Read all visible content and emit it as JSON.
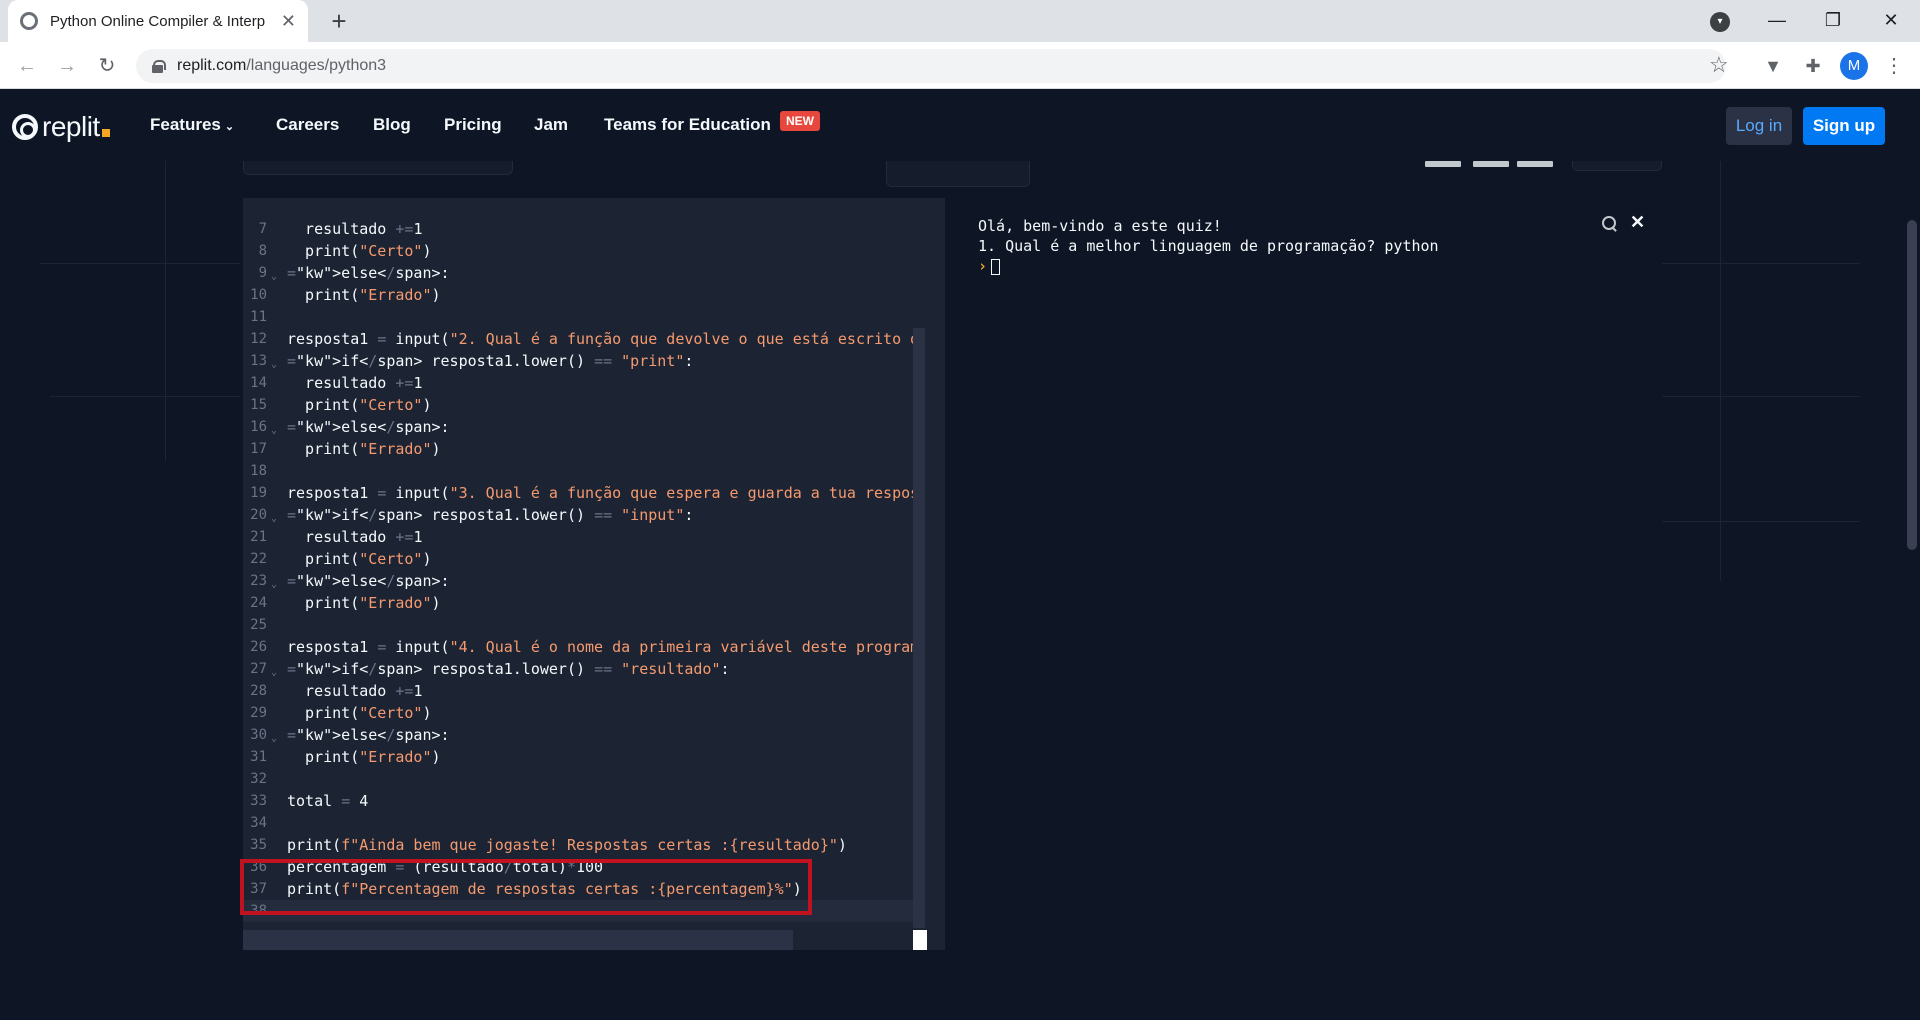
{
  "browser": {
    "tab_title": "Python Online Compiler & Interp",
    "url_host": "replit.com",
    "url_path": "/languages/python3",
    "profile_initial": "M"
  },
  "nav": {
    "logo_text": "replit",
    "items": [
      "Features",
      "Careers",
      "Blog",
      "Pricing",
      "Jam",
      "Teams for Education"
    ],
    "new_badge": "NEW",
    "login": "Log in",
    "signup": "Sign up"
  },
  "editor": {
    "lines": [
      {
        "n": "7",
        "code": "  resultado +=1"
      },
      {
        "n": "8",
        "code": "  print(\"Certo\")"
      },
      {
        "n": "9",
        "code": "else:",
        "fold": true
      },
      {
        "n": "10",
        "code": "  print(\"Errado\")"
      },
      {
        "n": "11",
        "code": ""
      },
      {
        "n": "12",
        "code": "resposta1 = input(\"2. Qual é a função que devolve o que está escrito d"
      },
      {
        "n": "13",
        "code": "if resposta1.lower() == \"print\":",
        "fold": true
      },
      {
        "n": "14",
        "code": "  resultado +=1"
      },
      {
        "n": "15",
        "code": "  print(\"Certo\")"
      },
      {
        "n": "16",
        "code": "else:",
        "fold": true
      },
      {
        "n": "17",
        "code": "  print(\"Errado\")"
      },
      {
        "n": "18",
        "code": ""
      },
      {
        "n": "19",
        "code": "resposta1 = input(\"3. Qual é a função que espera e guarda a tua respos"
      },
      {
        "n": "20",
        "code": "if resposta1.lower() == \"input\":",
        "fold": true
      },
      {
        "n": "21",
        "code": "  resultado +=1"
      },
      {
        "n": "22",
        "code": "  print(\"Certo\")"
      },
      {
        "n": "23",
        "code": "else:",
        "fold": true
      },
      {
        "n": "24",
        "code": "  print(\"Errado\")"
      },
      {
        "n": "25",
        "code": ""
      },
      {
        "n": "26",
        "code": "resposta1 = input(\"4. Qual é o nome da primeira variável deste program"
      },
      {
        "n": "27",
        "code": "if resposta1.lower() == \"resultado\":",
        "fold": true
      },
      {
        "n": "28",
        "code": "  resultado +=1"
      },
      {
        "n": "29",
        "code": "  print(\"Certo\")"
      },
      {
        "n": "30",
        "code": "else:",
        "fold": true
      },
      {
        "n": "31",
        "code": "  print(\"Errado\")"
      },
      {
        "n": "32",
        "code": ""
      },
      {
        "n": "33",
        "code": "total = 4"
      },
      {
        "n": "34",
        "code": ""
      },
      {
        "n": "35",
        "code": "print(f\"Ainda bem que jogaste! Respostas certas :{resultado}\")"
      },
      {
        "n": "36",
        "code": "percentagem = (resultado/total)*100"
      },
      {
        "n": "37",
        "code": "print(f\"Percentagem de respostas certas :{percentagem}%\")"
      },
      {
        "n": "38",
        "code": "",
        "active": true
      }
    ]
  },
  "console": {
    "lines": [
      "Olá, bem-vindo a este quiz!",
      "1. Qual é a melhor linguagem de programação? python"
    ],
    "prompt": "›"
  },
  "colors": {
    "page_bg": "#0e1525",
    "editor_bg": "#1c2333",
    "keyword": "#57abff",
    "string": "#f59a6e",
    "highlight_border": "#c1121f",
    "signup_bg": "#0079f2"
  }
}
